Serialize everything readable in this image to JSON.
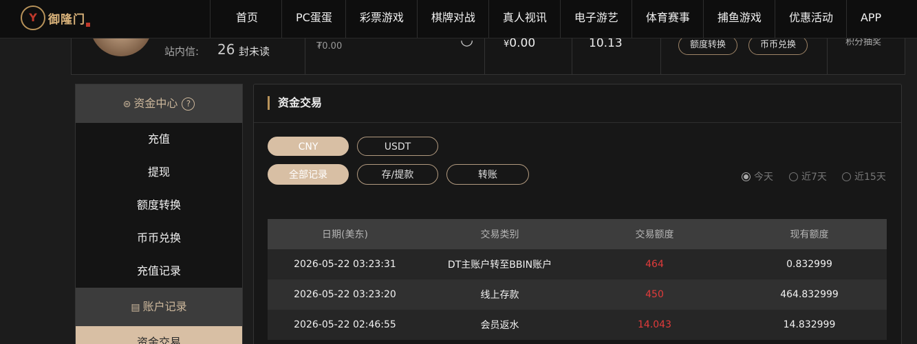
{
  "brand": {
    "logo_text": "御隆门"
  },
  "nav": {
    "items": [
      "首页",
      "PC蛋蛋",
      "彩票游戏",
      "棋牌对战",
      "真人视讯",
      "电子游艺",
      "体育赛事",
      "捕鱼游戏",
      "优惠活动",
      "APP"
    ]
  },
  "profile": {
    "message_label": "站内信:",
    "message_count": "26",
    "message_unit": "封未读",
    "small_balance": "₮0.00",
    "balance_currency": "¥",
    "balance_value": "0.00",
    "rebate_value": "10.13",
    "transfer_button": "额度转换",
    "exchange_button": "币币兑换",
    "points_text": "积分抽奖"
  },
  "sidebar": {
    "fund_center": "资金中心",
    "fund_items": [
      "充值",
      "提现",
      "额度转换",
      "币币兑换",
      "充值记录"
    ],
    "account_records": "账户记录",
    "account_items": [
      "资金交易"
    ]
  },
  "main": {
    "title": "资金交易",
    "currency_tabs": [
      "CNY",
      "USDT"
    ],
    "record_tabs": [
      "全部记录",
      "存/提款",
      "转账"
    ],
    "date_filters": [
      {
        "label": "今天",
        "checked": true
      },
      {
        "label": "近7天",
        "checked": false
      },
      {
        "label": "近15天",
        "checked": false
      }
    ],
    "table": {
      "columns": [
        "日期(美东)",
        "交易类别",
        "交易额度",
        "现有额度"
      ],
      "rows": [
        [
          "2026-05-22 03:23:31",
          "DT主账户转至BBIN账户",
          "464",
          "0.832999"
        ],
        [
          "2026-05-22 03:23:20",
          "线上存款",
          "450",
          "464.832999"
        ],
        [
          "2026-05-22 02:46:55",
          "会员返水",
          "14.043",
          "14.832999"
        ]
      ]
    }
  },
  "colors": {
    "accent_gold": "#d8bfa4",
    "amount_red": "#e23b3b",
    "nav_bg": "#0e0e0e"
  }
}
